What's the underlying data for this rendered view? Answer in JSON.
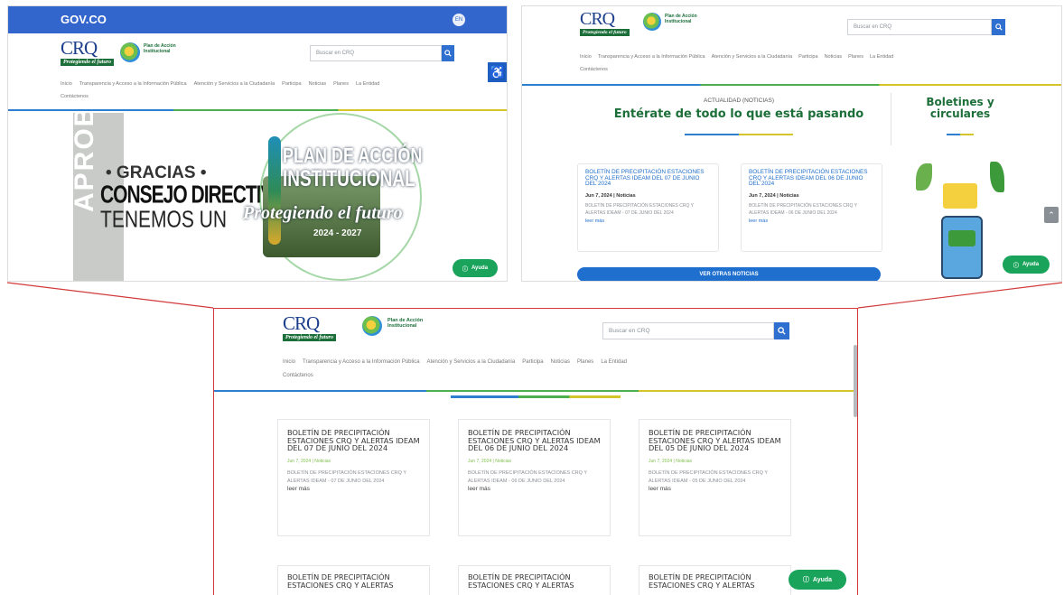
{
  "gov": {
    "label": "GOV.CO",
    "lang": "EN"
  },
  "brand": {
    "logo_text": "CRQ",
    "logo_sub": "Protegiendo el futuro",
    "plan_text": "Plan de Acción Institucional"
  },
  "search": {
    "placeholder": "Buscar en CRQ"
  },
  "nav": [
    "Inicio",
    "Transparencia y Acceso a la Información Pública",
    "Atención y Servicios a la Ciudadanía",
    "Participa",
    "Noticias",
    "Planes",
    "La Entidad",
    "Contáctenos"
  ],
  "hero": {
    "gracias": "• GRACIAS •",
    "consejo": "CONSEJO DIRECTIVO",
    "tenemos": "TENEMOS UN",
    "aprobado": "APROBADO",
    "plan_line1": "PLAN DE ACCIÓN",
    "plan_line2": "INSTITUCIONAL",
    "protegiendo": "Protegiendo el futuro",
    "years": "2024 - 2027"
  },
  "news": {
    "kicker": "ACTUALIDAD (NOTICIAS)",
    "headline": "Entérate de todo lo que está pasando",
    "boletines": "Boletines y circulares",
    "ver_otras": "VER OTRAS NOTICIAS"
  },
  "cards_small": [
    {
      "title": "BOLETÍN DE PRECIPITACIÓN ESTACIONES CRQ Y ALERTAS IDEAM DEL 07 DE JUNIO DEL 2024",
      "meta": "Jun 7, 2024 | Noticias",
      "desc": "BOLETÍN DE PRECIPITACIÓN ESTACIONES CRQ Y ALERTAS IDEAM - 07 DE JUNIO DEL 2024",
      "more": "leer más"
    },
    {
      "title": "BOLETÍN DE PRECIPITACIÓN ESTACIONES CRQ Y ALERTAS IDEAM DEL 06 DE JUNIO DEL 2024",
      "meta": "Jun 7, 2024 | Noticias",
      "desc": "BOLETÍN DE PRECIPITACIÓN ESTACIONES CRQ Y ALERTAS IDEAM - 06 DE JUNIO DEL 2024",
      "more": "leer más"
    }
  ],
  "cards_big": [
    {
      "title": "BOLETÍN DE PRECIPITACIÓN ESTACIONES CRQ Y ALERTAS IDEAM DEL 07 DE JUNIO DEL 2024",
      "meta": "Jun 7, 2024 | Noticias",
      "desc": "BOLETÍN DE PRECIPITACIÓN ESTACIONES CRQ Y ALERTAS IDEAM - 07 DE JUNIO DEL 2024",
      "more": "leer más"
    },
    {
      "title": "BOLETÍN DE PRECIPITACIÓN ESTACIONES CRQ Y ALERTAS IDEAM DEL 06 DE JUNIO DEL 2024",
      "meta": "Jun 7, 2024 | Noticias",
      "desc": "BOLETÍN DE PRECIPITACIÓN ESTACIONES CRQ Y ALERTAS IDEAM - 06 DE JUNIO DEL 2024",
      "more": "leer más"
    },
    {
      "title": "BOLETÍN DE PRECIPITACIÓN ESTACIONES CRQ Y ALERTAS IDEAM DEL 05 DE JUNIO DEL 2024",
      "meta": "Jun 7, 2024 | Noticias",
      "desc": "BOLETÍN DE PRECIPITACIÓN ESTACIONES CRQ Y ALERTAS IDEAM - 05 DE JUNIO DEL 2024",
      "more": "leer más"
    }
  ],
  "cards_partial": [
    "BOLETÍN DE PRECIPITACIÓN ESTACIONES CRQ Y ALERTAS",
    "BOLETÍN DE PRECIPITACIÓN ESTACIONES CRQ Y ALERTAS",
    "BOLETÍN DE PRECIPITACIÓN ESTACIONES CRQ Y ALERTAS"
  ],
  "ayuda": "Ayuda",
  "colors": {
    "gov_blue": "#3366cc",
    "brand_green": "#1d6f3a",
    "link_blue": "#1e6dc9",
    "ayuda_green": "#19a35b",
    "connector_red": "#d23a3a"
  }
}
